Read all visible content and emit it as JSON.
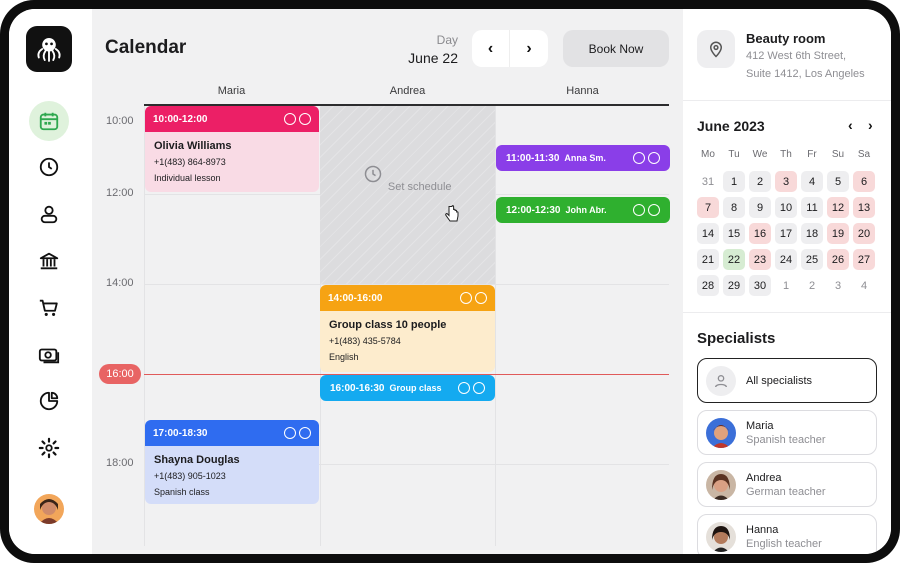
{
  "header": {
    "title": "Calendar",
    "day_label": "Day",
    "day_value": "June 22",
    "book_now": "Book Now"
  },
  "columns": [
    "Maria",
    "Andrea",
    "Hanna"
  ],
  "times": [
    "10:00",
    "12:00",
    "14:00",
    "16:00",
    "18:00"
  ],
  "blocked": {
    "label": "Set schedule"
  },
  "events": {
    "e1": {
      "time": "10:00-12:00",
      "name": "Olivia Williams",
      "phone": "+1(483) 864-8973",
      "note": "Individual lesson",
      "color": "#ec1f66"
    },
    "e2": {
      "time": "14:00-16:00",
      "name": "Group class 10 people",
      "phone": "+1(483) 435-5784",
      "note": "English",
      "color": "#f6a313"
    },
    "e3": {
      "time": "17:00-18:30",
      "name": "Shayna Douglas",
      "phone": "+1(483) 905-1023",
      "note": "Spanish class",
      "color": "#2f6cf0"
    },
    "e4": {
      "time": "11:00-11:30",
      "sub": "Anna Sm.",
      "color": "#8a3ee8"
    },
    "e5": {
      "time": "12:00-12:30",
      "sub": "John Abr.",
      "color": "#2fb02f"
    },
    "e6": {
      "time": "16:00-16:30",
      "sub": "Group class",
      "color": "#14aaf0"
    }
  },
  "location": {
    "name": "Beauty room",
    "addr1": "412 West 6th Street,",
    "addr2": "Suite 1412, Los Angeles"
  },
  "calendar": {
    "month": "June 2023",
    "dow": [
      "Mo",
      "Tu",
      "We",
      "Th",
      "Fr",
      "Su",
      "Sa"
    ],
    "days": [
      [
        "31",
        "1",
        "2",
        "3",
        "4",
        "5",
        "6"
      ],
      [
        "7",
        "8",
        "9",
        "10",
        "11",
        "12",
        "13"
      ],
      [
        "14",
        "15",
        "16",
        "17",
        "18",
        "19",
        "20"
      ],
      [
        "21",
        "22",
        "23",
        "24",
        "25",
        "26",
        "27"
      ],
      [
        "28",
        "29",
        "30",
        "1",
        "2",
        "3",
        "4"
      ]
    ]
  },
  "specialists": {
    "title": "Specialists",
    "all": "All specialists",
    "list": [
      {
        "name": "Maria",
        "role": "Spanish teacher"
      },
      {
        "name": "Andrea",
        "role": "German teacher"
      },
      {
        "name": "Hanna",
        "role": "English teacher"
      }
    ]
  },
  "colors": {
    "accent": "#e86464",
    "active_nav": "#dff2dc",
    "nav_icon": "#2fa84f"
  }
}
